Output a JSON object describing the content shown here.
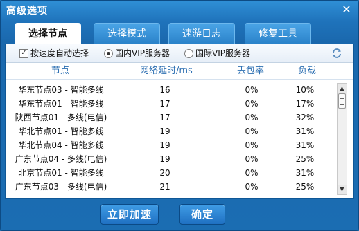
{
  "window": {
    "title": "高级选项",
    "close_glyph": "✕"
  },
  "tabs": [
    {
      "label": "选择节点",
      "active": true
    },
    {
      "label": "选择模式",
      "active": false
    },
    {
      "label": "速游日志",
      "active": false
    },
    {
      "label": "修复工具",
      "active": false
    }
  ],
  "options": {
    "auto_select": {
      "label": "按速度自动选择",
      "checked": true,
      "check_glyph": "✓"
    },
    "domestic_vip": {
      "label": "国内VIP服务器",
      "selected": true
    },
    "intl_vip": {
      "label": "国际VIP服务器",
      "selected": false
    },
    "refresh_icon": "refresh-icon"
  },
  "table": {
    "headers": {
      "node": "节点",
      "latency": "网络延时/ms",
      "loss": "丢包率",
      "load": "负载"
    },
    "rows": [
      {
        "node": "华东节点03 - 智能多线",
        "latency": "16",
        "loss": "0%",
        "load": "10%"
      },
      {
        "node": "华东节点01 - 智能多线",
        "latency": "17",
        "loss": "0%",
        "load": "17%"
      },
      {
        "node": "陕西节点01 - 多线(电信)",
        "latency": "17",
        "loss": "0%",
        "load": "32%"
      },
      {
        "node": "华北节点01 - 智能多线",
        "latency": "19",
        "loss": "0%",
        "load": "31%"
      },
      {
        "node": "华北节点04 - 智能多线",
        "latency": "19",
        "loss": "0%",
        "load": "31%"
      },
      {
        "node": "广东节点04 - 多线(电信)",
        "latency": "19",
        "loss": "0%",
        "load": "25%"
      },
      {
        "node": "北京节点01 - 智能多线",
        "latency": "20",
        "loss": "0%",
        "load": "31%"
      },
      {
        "node": "广东节点03 - 多线(电信)",
        "latency": "21",
        "loss": "0%",
        "load": "25%"
      }
    ]
  },
  "scrollbar": {
    "up_glyph": "▲",
    "down_glyph": "▼"
  },
  "buttons": {
    "accelerate": "立即加速",
    "ok": "确定"
  },
  "colors": {
    "accent": "#1f73bb",
    "header_text": "#2d6fb2"
  }
}
